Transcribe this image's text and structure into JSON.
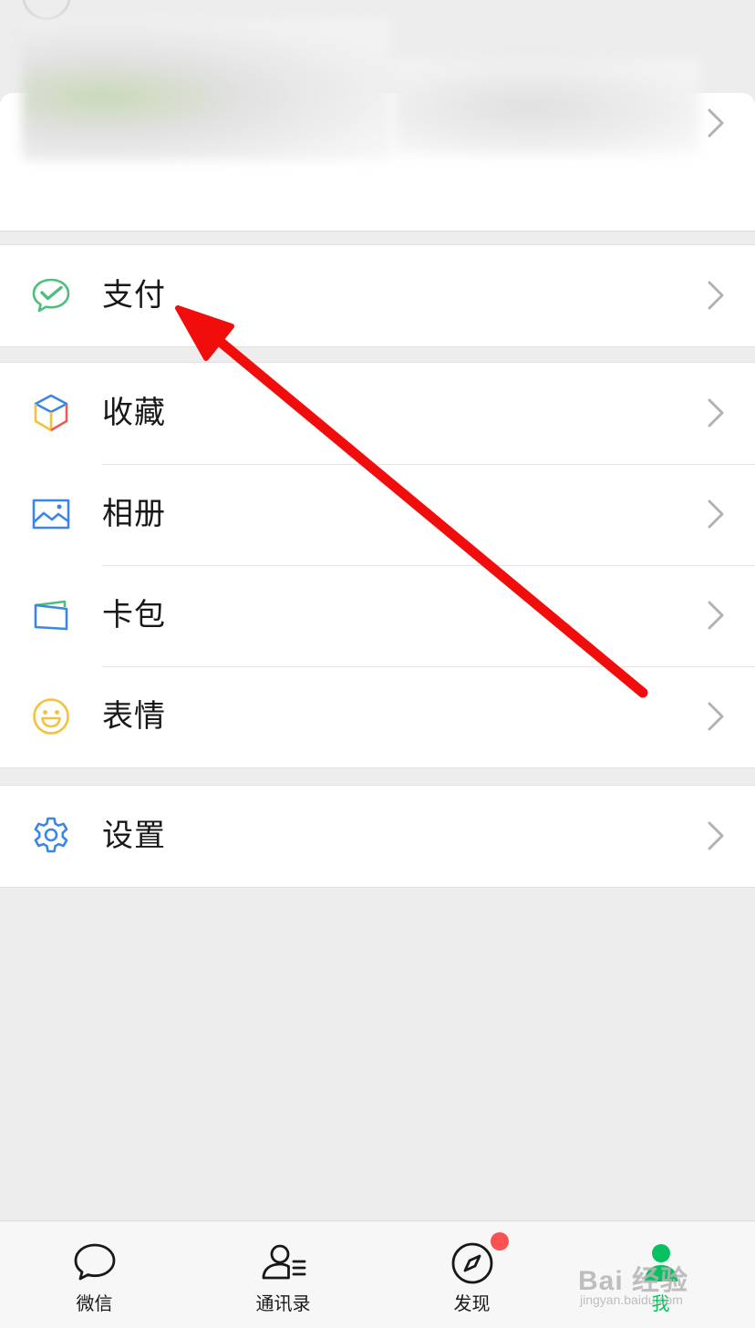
{
  "rows_payment": [
    {
      "label": "支付",
      "icon": "wechat-pay-icon"
    }
  ],
  "rows_main": [
    {
      "label": "收藏",
      "icon": "favorites-cube-icon"
    },
    {
      "label": "相册",
      "icon": "album-picture-icon"
    },
    {
      "label": "卡包",
      "icon": "card-wallet-icon"
    },
    {
      "label": "表情",
      "icon": "sticker-smiley-icon"
    }
  ],
  "rows_settings": [
    {
      "label": "设置",
      "icon": "gear-icon"
    }
  ],
  "tabbar": {
    "tabs": [
      {
        "label": "微信",
        "icon": "chat-bubble-icon",
        "active": false,
        "badge": false
      },
      {
        "label": "通讯录",
        "icon": "contacts-icon",
        "active": false,
        "badge": false
      },
      {
        "label": "发现",
        "icon": "compass-icon",
        "active": false,
        "badge": true
      },
      {
        "label": "我",
        "icon": "person-icon",
        "active": true,
        "badge": false
      }
    ]
  },
  "watermark": {
    "text": "Bai 经验",
    "sub": "jingyan.baidu.com"
  },
  "colors": {
    "accent": "#07c160",
    "badge": "#fa5151",
    "annotation_arrow": "#f20d0d",
    "background": "#ededed"
  }
}
